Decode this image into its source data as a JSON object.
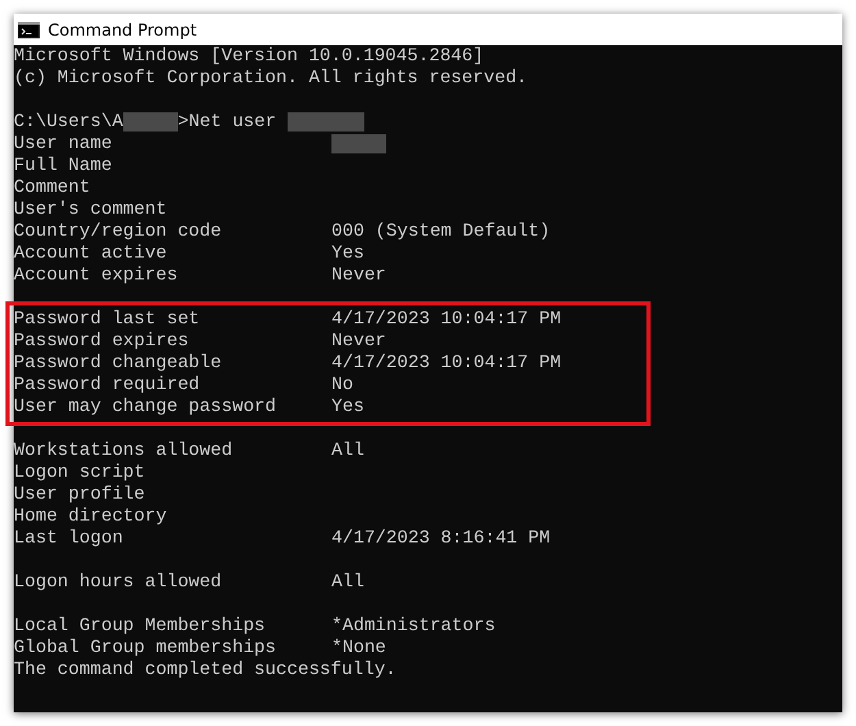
{
  "window": {
    "title": "Command Prompt"
  },
  "blocks": [
    {
      "highlighted": false,
      "lines": [
        {
          "kind": "text",
          "text": "Microsoft Windows [Version 10.0.19045.2846]"
        },
        {
          "kind": "text",
          "text": "(c) Microsoft Corporation. All rights reserved."
        },
        {
          "kind": "blank"
        },
        {
          "kind": "prompt",
          "path": "C:\\Users\\A",
          "command": ">Net user"
        },
        {
          "kind": "field",
          "label": "User name",
          "redacted": true
        },
        {
          "kind": "field",
          "label": "Full Name"
        },
        {
          "kind": "field",
          "label": "Comment"
        },
        {
          "kind": "field",
          "label": "User's comment"
        },
        {
          "kind": "field",
          "label": "Country/region code",
          "value": "000 (System Default)"
        },
        {
          "kind": "field",
          "label": "Account active",
          "value": "Yes"
        },
        {
          "kind": "field",
          "label": "Account expires",
          "value": "Never"
        }
      ]
    },
    {
      "highlighted": true,
      "lines": [
        {
          "kind": "field",
          "label": "Password last set",
          "value": "4/17/2023 10:04:17 PM"
        },
        {
          "kind": "field",
          "label": "Password expires",
          "value": "Never"
        },
        {
          "kind": "field",
          "label": "Password changeable",
          "value": "4/17/2023 10:04:17 PM"
        },
        {
          "kind": "field",
          "label": "Password required",
          "value": "No"
        },
        {
          "kind": "field",
          "label": "User may change password",
          "value": "Yes"
        }
      ]
    },
    {
      "highlighted": false,
      "lines": [
        {
          "kind": "field",
          "label": "Workstations allowed",
          "value": "All"
        },
        {
          "kind": "field",
          "label": "Logon script"
        },
        {
          "kind": "field",
          "label": "User profile"
        },
        {
          "kind": "field",
          "label": "Home directory"
        },
        {
          "kind": "field",
          "label": "Last logon",
          "value": "4/17/2023 8:16:41 PM"
        },
        {
          "kind": "blank"
        },
        {
          "kind": "field",
          "label": "Logon hours allowed",
          "value": "All"
        },
        {
          "kind": "blank"
        },
        {
          "kind": "field",
          "label": "Local Group Memberships",
          "value": "*Administrators"
        },
        {
          "kind": "field",
          "label": "Global Group memberships",
          "value": "*None"
        },
        {
          "kind": "text",
          "text": "The command completed successfully."
        }
      ]
    }
  ]
}
